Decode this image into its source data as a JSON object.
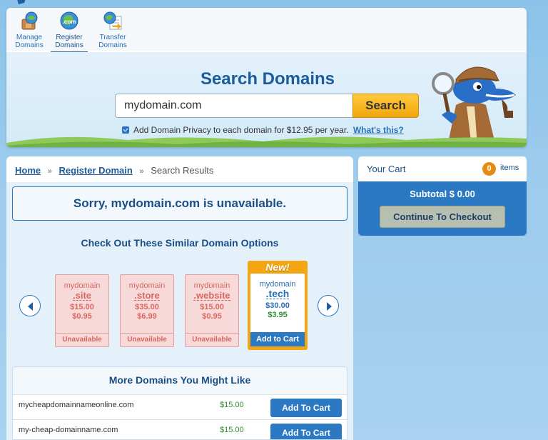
{
  "nav": {
    "tabs": [
      {
        "line1": "Manage",
        "line2": "Domains"
      },
      {
        "line1": "Register",
        "line2": "Domains"
      },
      {
        "line1": "Transfer",
        "line2": "Domains"
      }
    ],
    "active_tab": "Register Domains",
    "register_icon_text": ".com"
  },
  "search": {
    "title": "Search Domains",
    "value": "mydomain.com",
    "button_label": "Search",
    "privacy_text": "Add Domain Privacy to each domain for $12.95 per year.",
    "privacy_link": "What's this?",
    "privacy_checked": true
  },
  "breadcrumb": {
    "home": "Home",
    "register": "Register Domain",
    "current": "Search Results",
    "separator": "»"
  },
  "results": {
    "unavailable_message": "Sorry, mydomain.com is unavailable.",
    "similar_title": "Check Out These Similar Domain Options",
    "cards": [
      {
        "name": "mydomain",
        "tld": ".site",
        "price1": "$15.00",
        "price2": "$0.95",
        "status": "Unavailable"
      },
      {
        "name": "mydomain",
        "tld": ".store",
        "price1": "$35.00",
        "price2": "$6.99",
        "status": "Unavailable"
      },
      {
        "name": "mydomain",
        "tld": ".website",
        "price1": "$15.00",
        "price2": "$0.95",
        "status": "Unavailable"
      }
    ],
    "featured": {
      "badge": "New!",
      "name": "mydomain",
      "tld": ".tech",
      "price1": "$30.00",
      "price2": "$3.95",
      "button": "Add to Cart"
    },
    "more_title": "More Domains You Might Like",
    "more": [
      {
        "domain": "mycheapdomainnameonline.com",
        "price": "$15.00",
        "button": "Add To Cart"
      },
      {
        "domain": "my-cheap-domainname.com",
        "price": "$15.00",
        "button": "Add To Cart"
      }
    ]
  },
  "cart": {
    "title": "Your Cart",
    "count": "0",
    "items_label": "items",
    "subtotal": "Subtotal $ 0.00",
    "checkout_label": "Continue To Checkout"
  },
  "colors": {
    "brand_blue": "#1c5c9c",
    "accent_orange": "#f4a512",
    "unavailable_red": "#d9675f",
    "price_green": "#2f8a2f"
  }
}
